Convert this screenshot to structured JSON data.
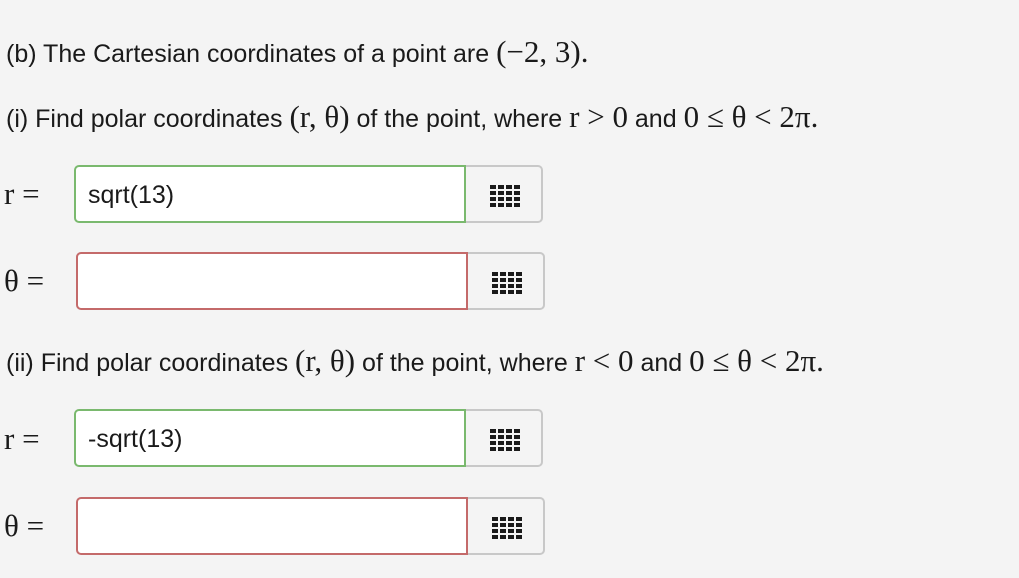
{
  "part_b": {
    "prefix": "(b) The Cartesian coordinates of a point are ",
    "point": "(−2, 3)",
    "suffix": "."
  },
  "part_i": {
    "prefix": "(i) Find polar coordinates ",
    "coords": "(r, θ)",
    "mid": " of the point, where ",
    "cond_r": "r > 0",
    "and": " and ",
    "cond_theta": "0 ≤ θ < 2π",
    "end": "."
  },
  "part_ii": {
    "prefix": "(ii) Find polar coordinates ",
    "coords": "(r, θ)",
    "mid": " of the point, where ",
    "cond_r": "r < 0",
    "and": " and ",
    "cond_theta": "0 ≤ θ < 2π",
    "end": "."
  },
  "answers": {
    "i_r_label": "r =",
    "i_r_value": "sqrt(13)",
    "i_theta_label": "θ =",
    "i_theta_value": "",
    "ii_r_label": "r =",
    "ii_r_value": "-sqrt(13)",
    "ii_theta_label": "θ =",
    "ii_theta_value": ""
  },
  "icons": {
    "keypad": "keypad-icon"
  },
  "colors": {
    "correct_border": "#7ab96e",
    "incorrect_border": "#c46a6a",
    "background": "#f4f4f4"
  }
}
